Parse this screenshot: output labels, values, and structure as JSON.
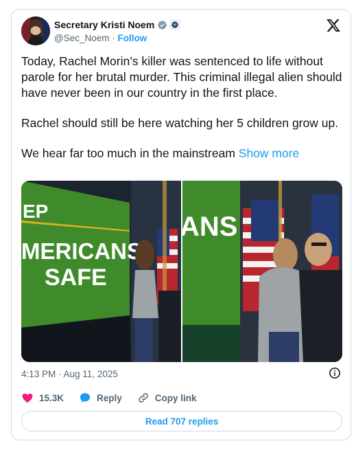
{
  "author": {
    "name": "Secretary Kristi Noem",
    "handle": "@Sec_Noem",
    "separator": "·",
    "follow_label": "Follow"
  },
  "post": {
    "paragraphs": [
      "Today, Rachel Morin’s killer was sentenced to life without parole for her brutal murder. This criminal illegal alien should have never been in our country in the first place.",
      "Rachel should still be here watching her 5 children grow up.",
      "We hear far too much in the mainstream"
    ],
    "show_more": "Show more"
  },
  "media": {
    "left_sign_lines": [
      "EP",
      "MERICANS",
      "SAFE"
    ],
    "right_sign_text": "ANS"
  },
  "timestamp": "4:13 PM · Aug 11, 2025",
  "actions": {
    "likes": "15.3K",
    "reply": "Reply",
    "copy_link": "Copy link"
  },
  "read_replies": "Read 707 replies",
  "colors": {
    "accent": "#1d9bf0",
    "like": "#f91880",
    "sign_green": "#3f8b2c"
  },
  "icons": [
    "verified-badge-icon",
    "government-badge-icon",
    "x-logo-icon",
    "info-icon",
    "heart-icon",
    "reply-bubble-icon",
    "link-icon"
  ]
}
